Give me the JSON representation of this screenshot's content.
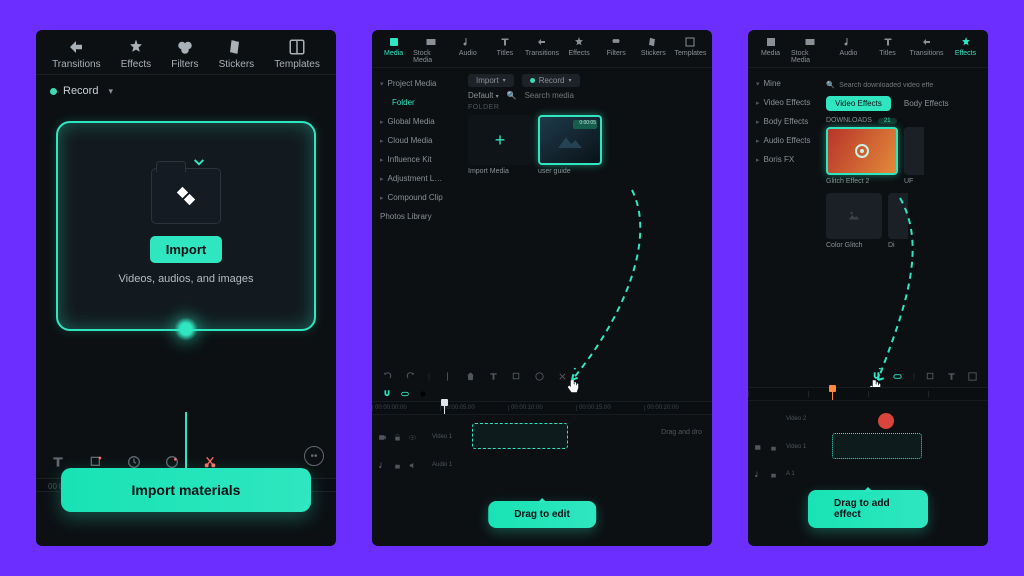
{
  "panel1": {
    "tabs": [
      "Transitions",
      "Effects",
      "Filters",
      "Stickers",
      "Templates"
    ],
    "record": "Record",
    "import_btn": "Import",
    "import_hint": "Videos, audios, and images",
    "cta": "Import materials",
    "ruler_start": "00 00"
  },
  "panel2": {
    "tabs": [
      "Media",
      "Stock Media",
      "Audio",
      "Titles",
      "Transitions",
      "Effects",
      "Filters",
      "Stickers",
      "Templates"
    ],
    "active_tab": "Media",
    "side": {
      "items": [
        "Project Media",
        "Folder",
        "Global Media",
        "Cloud Media",
        "Influence Kit",
        "Adjustment L…",
        "Compound Clip",
        "Photos Library"
      ],
      "active": "Folder"
    },
    "controls": {
      "import": "Import",
      "record": "Record",
      "default": "Default",
      "search": "Search media"
    },
    "section": "FOLDER",
    "cards": {
      "import": "Import Media",
      "user": "user guide",
      "dur": "0:00:05"
    },
    "timeline": {
      "ticks": [
        "00:00:00:00",
        "00:00:05:00",
        "00:00:10:00",
        "00:00:15:00",
        "00:00:20:00"
      ],
      "video": "Video 1",
      "audio": "Audio 1",
      "drag_hint": "Drag and dro"
    },
    "cta": "Drag to edit"
  },
  "panel3": {
    "tabs": [
      "Media",
      "Stock Media",
      "Audio",
      "Titles",
      "Transitions",
      "Effects"
    ],
    "active_tab": "Effects",
    "side": {
      "mine": "Mine",
      "items": [
        "Video Effects",
        "Body Effects",
        "Audio Effects",
        "Boris FX"
      ]
    },
    "pills": {
      "video": "Video Effects",
      "body": "Body Effects"
    },
    "downloads": {
      "label": "DOWNLOADS",
      "count": "21"
    },
    "search": "Search downloaded video effe",
    "cards": {
      "glitch": "Glitch Effect 2",
      "uft": "UF",
      "color": "Color Glitch",
      "dis": "Di"
    },
    "timeline": {
      "video2": "Video 2",
      "video1": "Video 1",
      "a1": "A 1"
    },
    "cta": "Drag to add effect"
  }
}
